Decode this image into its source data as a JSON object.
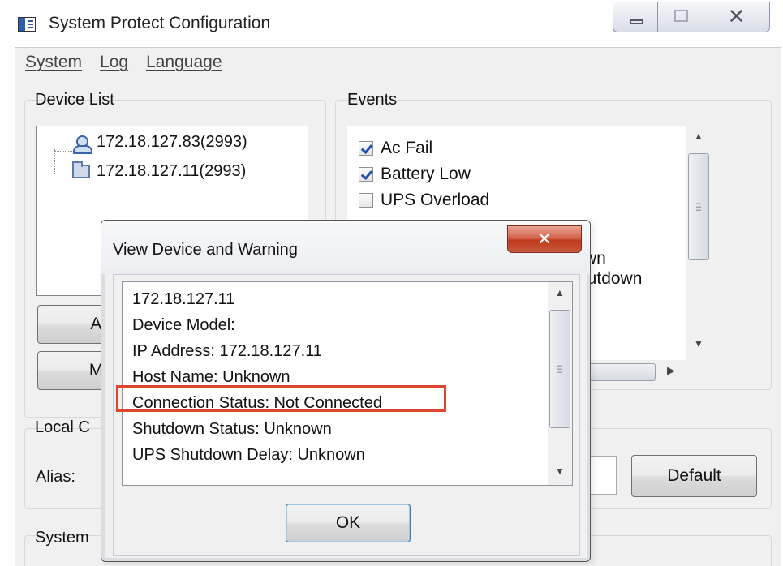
{
  "window": {
    "title": "System Protect Configuration",
    "icon": "app-window-icon",
    "caption_buttons": [
      "minimize-icon",
      "maximize-icon",
      "close-icon"
    ]
  },
  "menu": {
    "items": [
      {
        "label": "System"
      },
      {
        "label": "Log"
      },
      {
        "label": "Language"
      }
    ]
  },
  "device_list": {
    "label": "Device List",
    "items": [
      {
        "label": "172.18.127.83(2993)",
        "icon": "connected-device-icon"
      },
      {
        "label": "172.18.127.11(2993)",
        "icon": "folder-icon"
      }
    ],
    "buttons": [
      {
        "label": "Ad"
      },
      {
        "label": "Mo"
      }
    ]
  },
  "events": {
    "label": "Events",
    "items": [
      {
        "label": "Ac Fail",
        "checked": true
      },
      {
        "label": "Battery Low",
        "checked": true
      },
      {
        "label": "UPS Overload",
        "checked": false
      }
    ],
    "partial_items": [
      "wn",
      "hutdown"
    ]
  },
  "local": {
    "label": "Local C",
    "alias_label": "Alias:",
    "default_button": "Default"
  },
  "system_group": {
    "label": "System"
  },
  "dialog": {
    "title": "View Device and Warning",
    "close_icon": "close-icon",
    "lines": [
      "172.18.127.11",
      "Device Model:",
      "IP Address: 172.18.127.11",
      "Host Name: Unknown",
      "Connection Status: Not Connected",
      "Shutdown Status: Unknown",
      "UPS Shutdown Delay: Unknown"
    ],
    "ok_label": "OK",
    "highlight_color": "#e0452e"
  }
}
